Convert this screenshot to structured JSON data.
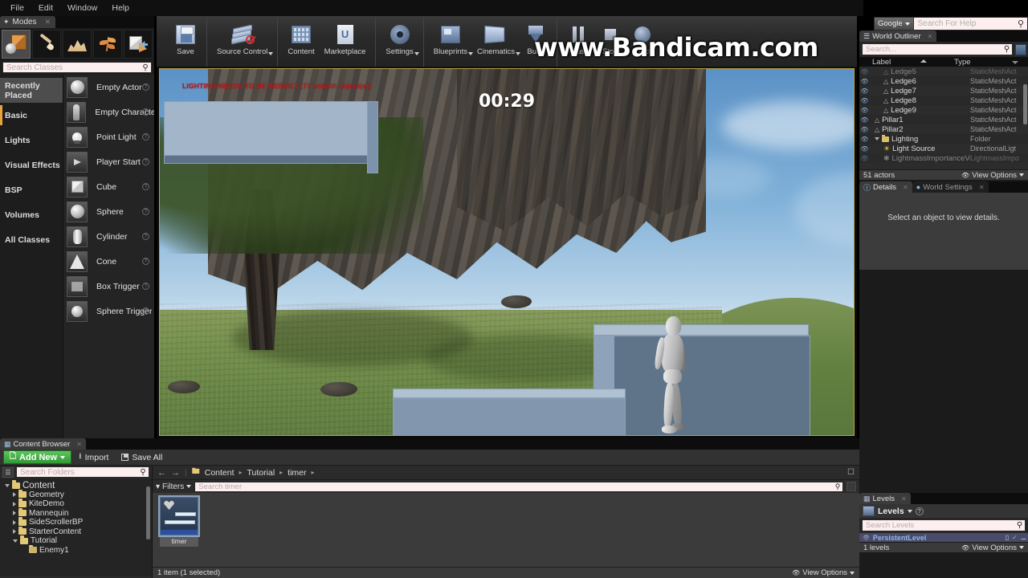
{
  "menubar": {
    "items": [
      "File",
      "Edit",
      "Window",
      "Help"
    ]
  },
  "help_search": {
    "provider_label": "Google",
    "placeholder": "Search For Help",
    "icon": "magnifier-icon"
  },
  "modes_panel": {
    "tab_label": "Modes",
    "mode_buttons": [
      {
        "name": "place-mode",
        "icon": "place-cube-icon",
        "selected": true
      },
      {
        "name": "paint-mode",
        "icon": "paint-brush-icon",
        "selected": false
      },
      {
        "name": "landscape-mode",
        "icon": "landscape-icon",
        "selected": false
      },
      {
        "name": "foliage-mode",
        "icon": "foliage-leaf-icon",
        "selected": false
      },
      {
        "name": "geometry-edit-mode",
        "icon": "geometry-edit-icon",
        "selected": false
      }
    ],
    "search": {
      "placeholder": "Search Classes",
      "icon": "magnifier-icon"
    },
    "categories": [
      {
        "label": "Recently Placed",
        "state": "hover"
      },
      {
        "label": "Basic",
        "state": "active"
      },
      {
        "label": "Lights",
        "state": "normal"
      },
      {
        "label": "Visual Effects",
        "state": "normal"
      },
      {
        "label": "BSP",
        "state": "normal"
      },
      {
        "label": "Volumes",
        "state": "normal"
      },
      {
        "label": "All Classes",
        "state": "normal"
      }
    ],
    "place_items": [
      {
        "label": "Empty Actor",
        "shape": "sh-sphere"
      },
      {
        "label": "Empty Character",
        "shape": "sh-char"
      },
      {
        "label": "Point Light",
        "shape": "sh-bulb"
      },
      {
        "label": "Player Start",
        "shape": "sh-flag"
      },
      {
        "label": "Cube",
        "shape": "sh-cube"
      },
      {
        "label": "Sphere",
        "shape": "sh-sphere"
      },
      {
        "label": "Cylinder",
        "shape": "sh-cyl"
      },
      {
        "label": "Cone",
        "shape": "sh-cone"
      },
      {
        "label": "Box Trigger",
        "shape": "sh-boxt"
      },
      {
        "label": "Sphere Trigger",
        "shape": "sh-spht"
      }
    ]
  },
  "toolbar": {
    "groups": [
      {
        "items": [
          {
            "label": "Save",
            "icon": "floppy-save-icon",
            "dropdown": false
          }
        ]
      },
      {
        "items": [
          {
            "label": "Source Control",
            "icon": "source-control-icon",
            "dropdown": true
          }
        ]
      },
      {
        "items": [
          {
            "label": "Content",
            "icon": "content-grid-icon",
            "dropdown": false
          },
          {
            "label": "Marketplace",
            "icon": "marketplace-bag-icon",
            "dropdown": false
          }
        ]
      },
      {
        "items": [
          {
            "label": "Settings",
            "icon": "gear-icon",
            "dropdown": true
          }
        ]
      },
      {
        "items": [
          {
            "label": "Blueprints",
            "icon": "blueprint-icon",
            "dropdown": true
          },
          {
            "label": "Cinematics",
            "icon": "cinematics-icon",
            "dropdown": true
          },
          {
            "label": "Build",
            "icon": "build-icon",
            "dropdown": true
          }
        ]
      },
      {
        "items": [
          {
            "label": "Pause",
            "icon": "pause-icon",
            "dropdown": false
          },
          {
            "label": "Stop",
            "icon": "stop-icon",
            "dropdown": false
          },
          {
            "label": "Eject",
            "icon": "eject-icon",
            "dropdown": false
          }
        ]
      }
    ]
  },
  "watermark": {
    "text": "www.Bandicam.com"
  },
  "viewport": {
    "lighting_warning": "LIGHTING NEEDS TO BE REBUILT (77 unbuilt object(s))",
    "lighting_warning_color": "#c42020",
    "timer": "00:29",
    "timer_color": "#ffffff",
    "border_color": "#b8a24a",
    "platform_color": "#9fb2c6"
  },
  "world_outliner": {
    "tab_label": "World Outliner",
    "search": {
      "placeholder": "Search...",
      "icon": "magnifier-icon"
    },
    "columns": [
      "Label",
      "Type"
    ],
    "sort": "ascending",
    "rows": [
      {
        "label": "Ledge5",
        "type": "StaticMeshAct",
        "icon": "mesh-icon",
        "indent": 1,
        "clipped": true
      },
      {
        "label": "Ledge6",
        "type": "StaticMeshAct",
        "icon": "mesh-icon",
        "indent": 1
      },
      {
        "label": "Ledge7",
        "type": "StaticMeshAct",
        "icon": "mesh-icon",
        "indent": 1
      },
      {
        "label": "Ledge8",
        "type": "StaticMeshAct",
        "icon": "mesh-icon",
        "indent": 1
      },
      {
        "label": "Ledge9",
        "type": "StaticMeshAct",
        "icon": "mesh-icon",
        "indent": 1
      },
      {
        "label": "Pillar1",
        "type": "StaticMeshAct",
        "icon": "mesh-icon",
        "indent": 0
      },
      {
        "label": "Pillar2",
        "type": "StaticMeshAct",
        "icon": "mesh-icon",
        "indent": 0
      },
      {
        "label": "Lighting",
        "type": "Folder",
        "icon": "folder-icon",
        "indent": 0,
        "expanded": true
      },
      {
        "label": "Light Source",
        "type": "DirectionalLigt",
        "icon": "sun-icon",
        "indent": 1
      },
      {
        "label": "LightmassImportanceVo",
        "type": "LightmassImpo",
        "icon": "star-icon",
        "indent": 1,
        "clipped": true
      }
    ],
    "status": {
      "count": "51 actors",
      "view_options": "View Options",
      "eye_icon": "eye-icon"
    }
  },
  "details": {
    "tabs": [
      {
        "label": "Details",
        "icon": "info-icon",
        "active": true
      },
      {
        "label": "World Settings",
        "icon": "globe-icon",
        "active": false
      }
    ],
    "empty_message": "Select an object to view details."
  },
  "levels": {
    "tab_label": "Levels",
    "toolbar_label": "Levels",
    "search": {
      "placeholder": "Search Levels",
      "icon": "magnifier-icon"
    },
    "rows": [
      {
        "label": "PersistentLevel"
      }
    ],
    "status": {
      "count": "1 levels",
      "view_options": "View Options",
      "eye_icon": "eye-icon"
    }
  },
  "content_browser": {
    "tab_label": "Content Browser",
    "toolbar": {
      "add_new": "Add New",
      "import": "Import",
      "save_all": "Save All"
    },
    "folder_search": {
      "placeholder": "Search Folders",
      "icon": "magnifier-icon"
    },
    "tree": [
      {
        "label": "Content",
        "depth": 0,
        "expanded": true
      },
      {
        "label": "Geometry",
        "depth": 1,
        "collapsed": true
      },
      {
        "label": "KiteDemo",
        "depth": 1,
        "collapsed": true
      },
      {
        "label": "Mannequin",
        "depth": 1,
        "collapsed": true
      },
      {
        "label": "SideScrollerBP",
        "depth": 1,
        "collapsed": true
      },
      {
        "label": "StarterContent",
        "depth": 1,
        "collapsed": true
      },
      {
        "label": "Tutorial",
        "depth": 1,
        "expanded": true
      },
      {
        "label": "Enemy1",
        "depth": 2
      }
    ],
    "breadcrumb": [
      "Content",
      "Tutorial",
      "timer"
    ],
    "filters_label": "Filters",
    "asset_search": {
      "placeholder": "Search timer",
      "icon": "magnifier-icon"
    },
    "assets": [
      {
        "name": "timer",
        "selected": true,
        "thumb": "widget-blueprint-thumb"
      }
    ],
    "status": {
      "count": "1 item (1 selected)",
      "view_options": "View Options",
      "eye_icon": "eye-icon"
    }
  }
}
